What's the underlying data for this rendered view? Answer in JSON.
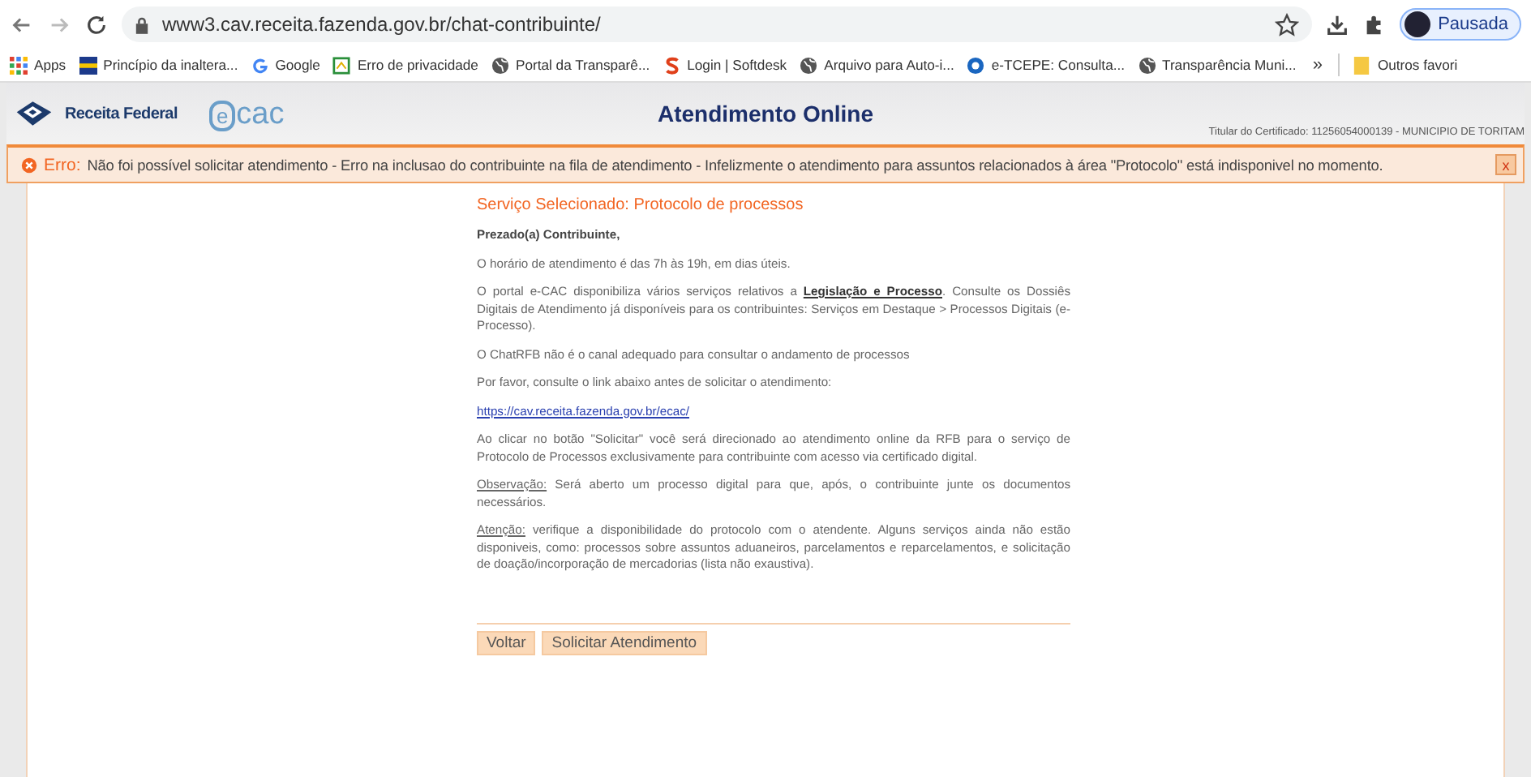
{
  "browser": {
    "url": "www3.cav.receita.fazenda.gov.br/chat-contribuinte/",
    "profile": "Pausada",
    "bookmarks": [
      {
        "kind": "apps",
        "label": "Apps"
      },
      {
        "kind": "flag",
        "label": "Princípio da inaltera..."
      },
      {
        "kind": "google",
        "label": "Google"
      },
      {
        "kind": "sheet",
        "label": "Erro de privacidade"
      },
      {
        "kind": "globe",
        "label": "Portal da Transparê..."
      },
      {
        "kind": "s",
        "label": "Login | Softdesk"
      },
      {
        "kind": "globe",
        "label": "Arquivo para Auto-i..."
      },
      {
        "kind": "blue",
        "label": "e-TCEPE: Consulta..."
      },
      {
        "kind": "globe",
        "label": "Transparência Muni..."
      }
    ],
    "more": "»",
    "other_folder": "Outros favori"
  },
  "header": {
    "brand": "Receita Federal",
    "ecac": "cac",
    "ecac_e": "e",
    "title": "Atendimento Online",
    "certificate": "Titular do Certificado: 11256054000139 - MUNICIPIO DE TORITAM"
  },
  "error": {
    "label": "Erro:",
    "message": "Não foi possível solicitar atendimento - Erro na inclusao do contribuinte na fila de atendimento - Infelizmente o atendimento para assuntos relacionados à área \"Protocolo\" está indisponivel no momento.",
    "close": "x"
  },
  "content": {
    "heading": "Serviço Selecionado: Protocolo de processos",
    "paragraphs": [
      {
        "kind": "greeting",
        "text": "Prezado(a) Contribuinte,"
      },
      {
        "kind": "text",
        "text": "O horário de atendimento é das 7h às 19h, em dias úteis."
      },
      {
        "kind": "inline_link",
        "before": "O portal e-CAC disponibiliza vários serviços relativos a",
        "link": "Legislação e Processo",
        "after": ". Consulte os Dossiês Digitais de Atendimento já disponíveis para os contribuintes: Serviços em Destaque > Processos Digitais (e-Processo)."
      },
      {
        "kind": "text",
        "text": "O ChatRFB não é o canal adequado para consultar o andamento de processos"
      },
      {
        "kind": "text",
        "text": "Por favor, consulte o link abaixo antes de solicitar o atendimento:"
      },
      {
        "kind": "url",
        "text": "https://cav.receita.fazenda.gov.br/ecac/"
      },
      {
        "kind": "text",
        "text": "Ao clicar no botão \"Solicitar\" você será direcionado ao atendimento online da RFB para o serviço de Protocolo de Processos exclusivamente para contribuinte com acesso via certificado digital."
      },
      {
        "kind": "labeled",
        "label": "Observação:",
        "text": "Será aberto um processo digital para que, após, o contribuinte junte os documentos necessários."
      },
      {
        "kind": "labeled",
        "label": "Atenção:",
        "text": "verifique a disponibilidade do protocolo com o atendente. Alguns serviços ainda não estão disponiveis, como: processos sobre assuntos aduaneiros, parcelamentos e reparcelamentos,  e solicitação de doação/incorporação de mercadorias (lista não exaustiva)."
      }
    ],
    "buttons": [
      "Voltar",
      "Solicitar Atendimento"
    ]
  }
}
